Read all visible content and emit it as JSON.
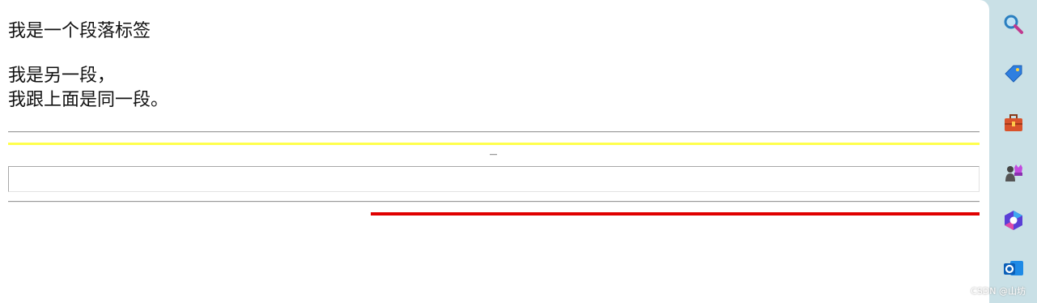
{
  "content": {
    "paragraph_1": "我是一个段落标签",
    "paragraph_2_line_1": "我是另一段，",
    "paragraph_2_line_2": "我跟上面是同一段。"
  },
  "colors": {
    "page_bg": "#ffffff",
    "sidebar_bg": "#c9e0e6",
    "rule_gray": "#9a9a9a",
    "rule_yellow": "#ffff4d",
    "rule_red": "#e00000"
  },
  "sidebar": {
    "items": [
      {
        "icon": "search-icon"
      },
      {
        "icon": "tag-icon"
      },
      {
        "icon": "toolbox-icon"
      },
      {
        "icon": "games-icon"
      },
      {
        "icon": "copilot-icon"
      },
      {
        "icon": "outlook-icon"
      }
    ]
  },
  "watermark": "CSDN @山坊"
}
